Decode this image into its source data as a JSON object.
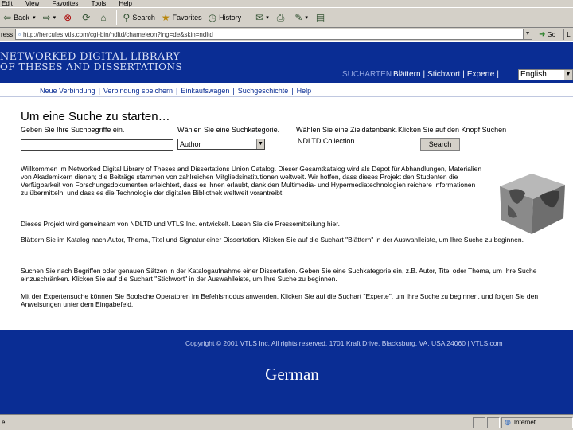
{
  "browser": {
    "menu": [
      "Edit",
      "View",
      "Favorites",
      "Tools",
      "Help"
    ],
    "toolbar": {
      "back": "Back",
      "search": "Search",
      "favorites": "Favorites",
      "history": "History"
    },
    "address": {
      "label": "ress",
      "url": "http://hercules.vtls.com/cgi-bin/ndltd/chameleon?lng=de&skin=ndltd",
      "go": "Go",
      "links": "Li"
    },
    "status": {
      "left": "e",
      "zone": "Internet"
    }
  },
  "header": {
    "logo_line1": "NETWORKED DIGITAL LIBRARY",
    "logo_line2": "OF THESES AND DISSERTATIONS",
    "nav_dim": "SUCHARTEN",
    "nav": [
      "Blättern",
      "Stichwort",
      "Experte"
    ],
    "language": "English"
  },
  "subnav": [
    "Neue Verbindung",
    "Verbindung speichern",
    "Einkaufswagen",
    "Suchgeschichte",
    "Help"
  ],
  "main": {
    "title": "Um eine Suche zu starten…",
    "label_term": "Geben Sie Ihre Suchbegriffe ein.",
    "label_category": "Wählen Sie eine Suchkategorie.",
    "label_database": "Wählen Sie eine Zieldatenbank.",
    "label_click": "Klicken Sie auf den Knopf Suchen",
    "category_value": "Author",
    "database_value": "NDLTD Collection",
    "search_button": "Search",
    "paragraphs": [
      "Willkommen im Networked Digital Library of Theses and Dissertations Union Catalog. Dieser Gesamtkatalog wird als Depot für Abhandlungen, Materialien von Akademikern dienen; die Beiträge stammen von zahlreichen Mitgliedsinstitutionen weltweit. Wir hoffen, dass dieses Projekt den Studenten die Verfügbarkeit von Forschungsdokumenten erleichtert, dass es ihnen erlaubt, dank den Multimedia- und Hypermediatechnologien reichere Informationen zu übermitteln, und dass es die Technologie der digitalen Bibliothek weltweit vorantreibt.",
      "Dieses Projekt wird gemeinsam von NDLTD und VTLS Inc. entwickelt. Lesen Sie die Pressemitteilung hier.",
      "Blättern Sie im Katalog nach Autor, Thema, Titel und Signatur einer Dissertation. Klicken Sie auf die Suchart \"Blättern\" in der Auswahlleiste, um Ihre Suche zu beginnen.",
      "Suchen Sie nach Begriffen oder genauen Sätzen in der Katalogaufnahme einer Dissertation. Geben Sie eine Suchkategorie ein, z.B. Autor, Titel oder Thema, um Ihre Suche einzuschränken. Klicken Sie auf die Suchart \"Stichwort\" in der Auswahlleiste, um Ihre Suche zu beginnen.",
      "Mit der Expertensuche können Sie Boolsche Operatoren im Befehlsmodus anwenden. Klicken Sie auf die Suchart \"Experte\", um Ihre Suche zu beginnen, und folgen Sie den Anweisungen unter dem Eingabefeld."
    ]
  },
  "footer": {
    "copyright": "Copyright © 2001 VTLS Inc. All rights reserved. 1701 Kraft Drive, Blacksburg, VA, USA 24060 | VTLS.com",
    "caption": "German"
  },
  "colors": {
    "brand_blue": "#0a2d94",
    "chrome_gray": "#d4d0c8"
  }
}
